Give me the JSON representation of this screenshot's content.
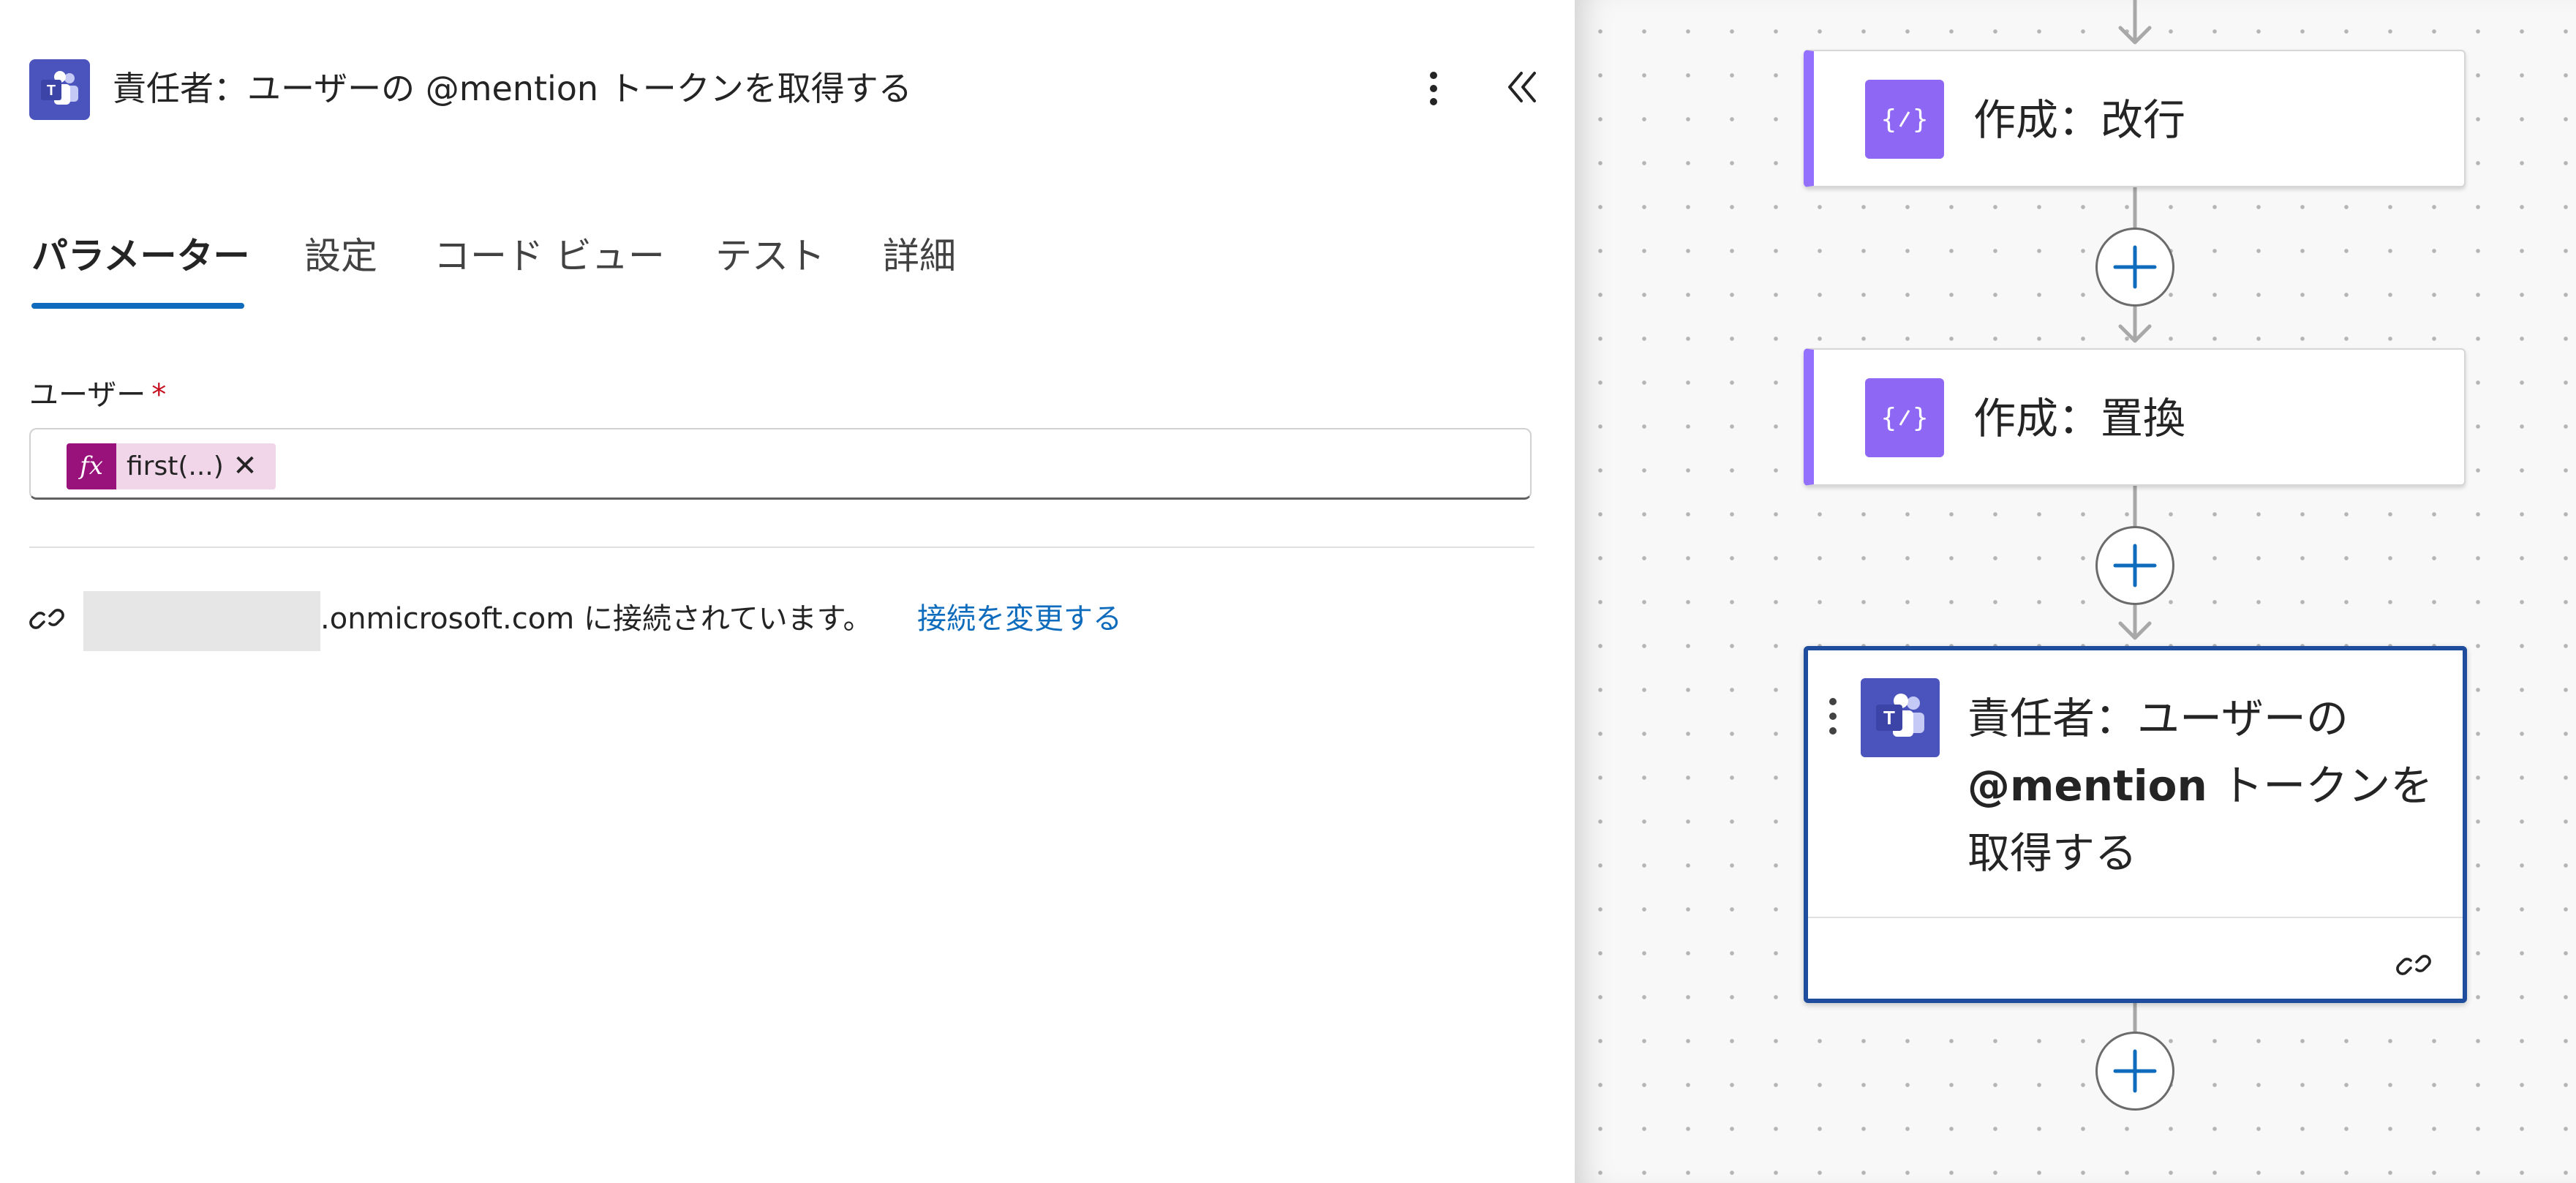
{
  "panel": {
    "title": "責任者：ユーザーの @mention トークンを取得する",
    "icon": "teams-icon",
    "tabs": [
      {
        "label": "パラメーター",
        "active": true
      },
      {
        "label": "設定",
        "active": false
      },
      {
        "label": "コード ビュー",
        "active": false
      },
      {
        "label": "テスト",
        "active": false
      },
      {
        "label": "詳細",
        "active": false
      }
    ],
    "user_field": {
      "label": "ユーザー",
      "required_mark": "*",
      "token_icon": "fx",
      "token_text": "first(...)",
      "token_remove": "✕"
    },
    "connection": {
      "text": ".onmicrosoft.com に接続されています。",
      "change_link": "接続を変更する"
    }
  },
  "canvas": {
    "nodes": [
      {
        "title": "作成：改行",
        "icon": "compose-icon"
      },
      {
        "title": "作成：置換",
        "icon": "compose-icon"
      },
      {
        "title_lines": [
          "責任者：ユーザーの",
          "@mention トークンを",
          "取得する"
        ],
        "icon": "teams-icon",
        "selected": true
      }
    ]
  },
  "colors": {
    "accent": "#0f6cbd",
    "teams": "#4b53bc",
    "compose": "#8e67f5",
    "compose_border": "#9470ff",
    "token": "#99117a",
    "selected_border": "#1f4d9e"
  }
}
